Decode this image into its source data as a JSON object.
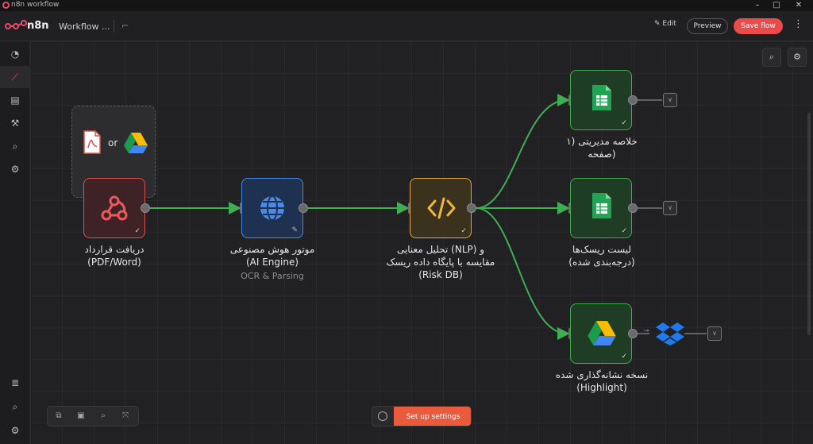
{
  "window": {
    "title": "n8n workflow",
    "minimize": "–",
    "maximize": "□",
    "close": "✕"
  },
  "header": {
    "logo_text": "n8n",
    "workflow_name": "Workflow ...",
    "tag_icon": "⌐",
    "edit_label": "Edit",
    "preview_label": "Preview",
    "save_label": "Save flow",
    "more_icon": "⋮"
  },
  "sidebar": {
    "items": [
      {
        "icon": "dashboard-icon",
        "glyph": "◔"
      },
      {
        "icon": "executions-icon",
        "glyph": "⟋"
      },
      {
        "icon": "templates-icon",
        "glyph": "▤"
      },
      {
        "icon": "tools-icon",
        "glyph": "⚒"
      },
      {
        "icon": "search-icon",
        "glyph": "⌕"
      },
      {
        "icon": "settings-icon",
        "glyph": "⚙"
      }
    ],
    "bottom_items": [
      {
        "icon": "docs-icon",
        "glyph": "≣"
      },
      {
        "icon": "search-icon",
        "glyph": "⌕"
      },
      {
        "icon": "gear-icon",
        "glyph": "⚙"
      }
    ]
  },
  "canvas_tools": {
    "zoom_glyph": "⌕",
    "settings_glyph": "⚙"
  },
  "input_group": {
    "or_text": "or"
  },
  "nodes": {
    "webhook": {
      "label_line1": "دریافت قرارداد",
      "label_line2": "(PDF/Word)"
    },
    "ai": {
      "label_line1": "موتور هوش مصنوعی",
      "label_line2": "(AI Engine)",
      "sub": "OCR & Parsing"
    },
    "nlp": {
      "label_line1": "تحلیل معنایی (NLP) و",
      "label_line2": "مقایسه با پایگاه داده ریسک",
      "label_line3": "(Risk DB)"
    },
    "summary": {
      "label_line1": "خلاصه مدیریتی (۱",
      "label_line2": "صفحه)"
    },
    "risks": {
      "label_line1": "لیست ریسک‌ها",
      "label_line2": "(درجه‌بندی شده)"
    },
    "highlight": {
      "label_line1": "نسخه نشانه‌گذاری شده",
      "label_line2": "(Highlight)"
    }
  },
  "bottom_bar": {
    "setup_label": "Set up settings"
  },
  "colors": {
    "accent": "#ea4b71",
    "edge": "#3fae52",
    "node_green": "#3fae52",
    "node_red": "#d9534f",
    "node_blue": "#4a8ae6",
    "node_yellow": "#e2a93a",
    "save": "#ea4b4b"
  }
}
